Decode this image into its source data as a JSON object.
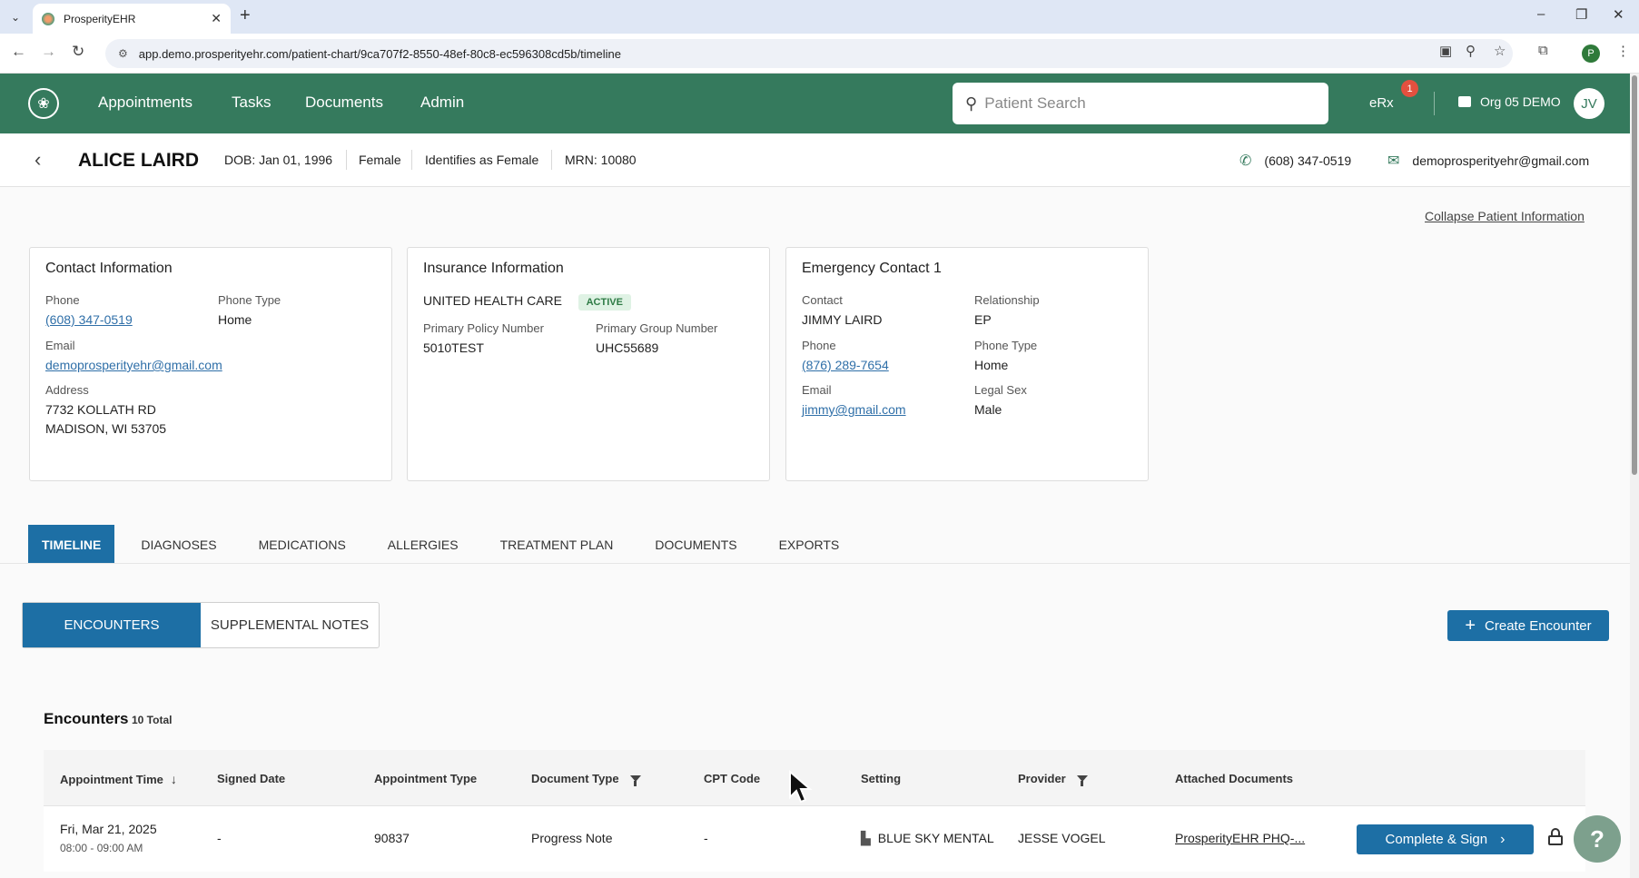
{
  "browser": {
    "tab_title": "ProsperityEHR",
    "url": "app.demo.prosperityehr.com/patient-chart/9ca707f2-8550-48ef-80c8-ec596308cd5b/timeline",
    "profile_initial": "P"
  },
  "nav": {
    "links": [
      "Appointments",
      "Tasks",
      "Documents",
      "Admin"
    ],
    "search_placeholder": "Patient Search",
    "erx_label": "eRx",
    "erx_badge": "1",
    "org": "Org 05 DEMO",
    "avatar": "JV",
    "brand_color": "#357a5d"
  },
  "patient": {
    "name": "ALICE LAIRD",
    "dob": "DOB: Jan 01, 1996",
    "sex": "Female",
    "gender_identity": "Identifies as Female",
    "mrn": "MRN: 10080",
    "phone": "(608) 347-0519",
    "email": "demoprosperityehr@gmail.com"
  },
  "collapse_label": "Collapse Patient Information",
  "contact_card": {
    "title": "Contact Information",
    "phone_label": "Phone",
    "phone": "(608) 347-0519",
    "phone_type_label": "Phone Type",
    "phone_type": "Home",
    "email_label": "Email",
    "email": "demoprosperityehr@gmail.com",
    "address_label": "Address",
    "address_line1": "7732 KOLLATH RD",
    "address_line2": "MADISON, WI 53705"
  },
  "insurance_card": {
    "title": "Insurance Information",
    "carrier": "UNITED HEALTH CARE",
    "status": "ACTIVE",
    "policy_label": "Primary Policy Number",
    "policy": "5010TEST",
    "group_label": "Primary Group Number",
    "group": "UHC55689"
  },
  "emergency_card": {
    "title": "Emergency Contact 1",
    "contact_label": "Contact",
    "contact": "JIMMY LAIRD",
    "relationship_label": "Relationship",
    "relationship": "EP",
    "phone_label": "Phone",
    "phone": "(876) 289-7654",
    "phone_type_label": "Phone Type",
    "phone_type": "Home",
    "email_label": "Email",
    "email": "jimmy@gmail.com",
    "legal_sex_label": "Legal Sex",
    "legal_sex": "Male"
  },
  "tabs": [
    "TIMELINE",
    "DIAGNOSES",
    "MEDICATIONS",
    "ALLERGIES",
    "TREATMENT PLAN",
    "DOCUMENTS",
    "EXPORTS"
  ],
  "subtabs": [
    "ENCOUNTERS",
    "SUPPLEMENTAL NOTES"
  ],
  "create_button": "Create Encounter",
  "encounters": {
    "title": "Encounters",
    "count": "10 Total",
    "columns": [
      "Appointment Time",
      "Signed Date",
      "Appointment Type",
      "Document Type",
      "CPT Code",
      "Setting",
      "Provider",
      "Attached Documents"
    ],
    "rows": [
      {
        "date": "Fri, Mar 21, 2025",
        "time": "08:00 - 09:00 AM",
        "signed": "-",
        "appt_type": "90837",
        "doc_type": "Progress Note",
        "cpt": "-",
        "setting": "BLUE SKY MENTAL",
        "provider": "JESSE VOGEL",
        "attached": "ProsperityEHR PHQ-...",
        "action": "Complete & Sign"
      }
    ]
  }
}
